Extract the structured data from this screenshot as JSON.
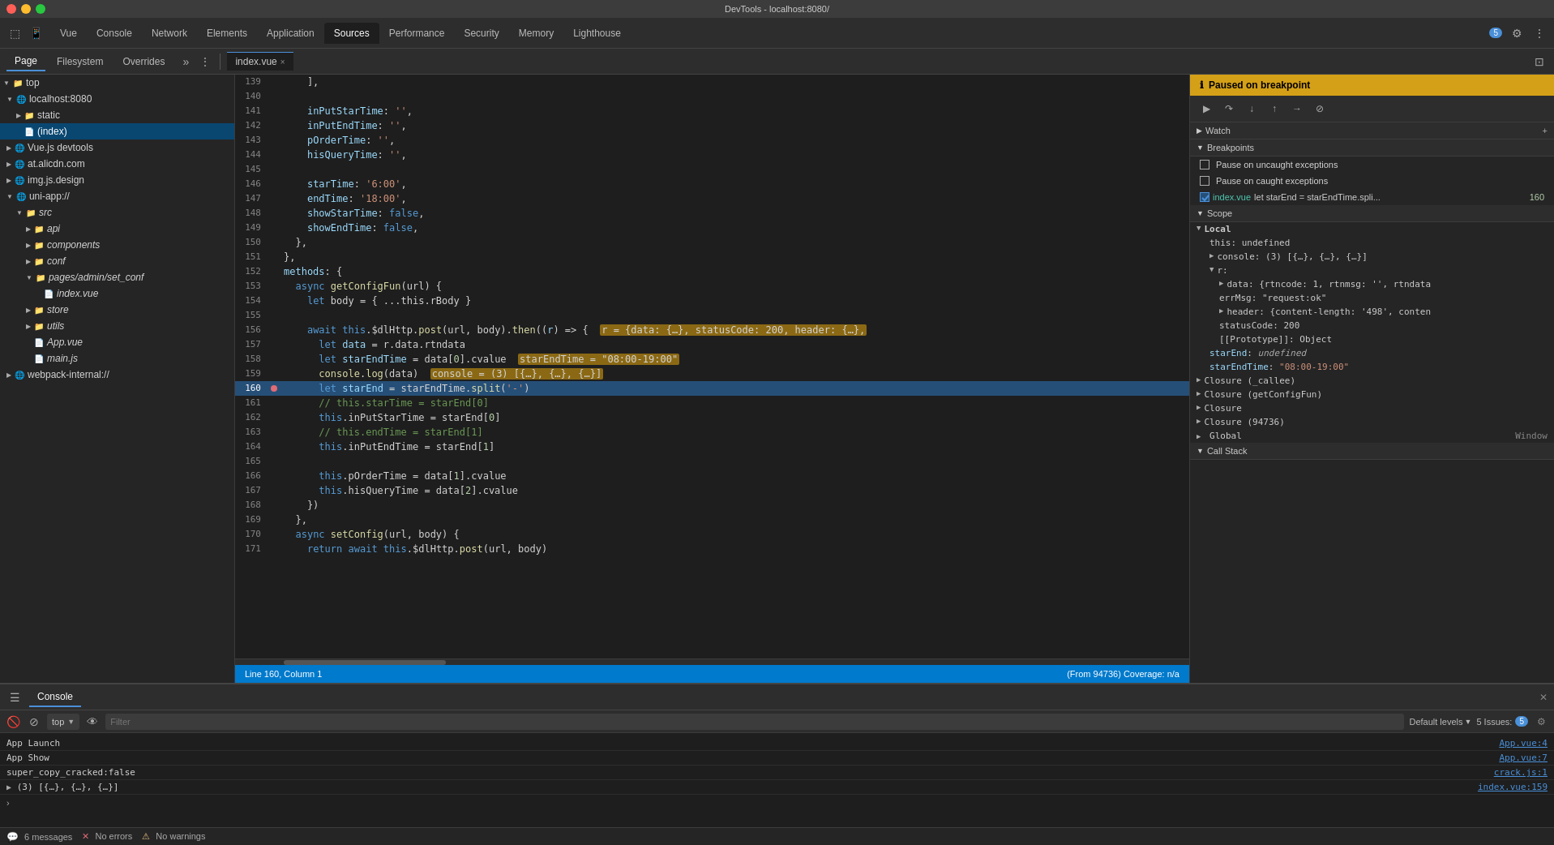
{
  "titlebar": {
    "title": "DevTools - localhost:8080/"
  },
  "nav": {
    "tabs": [
      {
        "label": "Vue",
        "active": false
      },
      {
        "label": "Console",
        "active": false
      },
      {
        "label": "Network",
        "active": false
      },
      {
        "label": "Elements",
        "active": false
      },
      {
        "label": "Application",
        "active": false
      },
      {
        "label": "Sources",
        "active": true
      },
      {
        "label": "Performance",
        "active": false
      },
      {
        "label": "Security",
        "active": false
      },
      {
        "label": "Memory",
        "active": false
      },
      {
        "label": "Lighthouse",
        "active": false
      }
    ],
    "badge": "5",
    "settings_label": "⚙",
    "more_label": "⋮"
  },
  "subtabs": [
    {
      "label": "Page",
      "active": true
    },
    {
      "label": "Filesystem",
      "active": false
    },
    {
      "label": "Overrides",
      "active": false
    }
  ],
  "file_tab": {
    "label": "index.vue",
    "close": "×"
  },
  "sidebar": {
    "items": [
      {
        "label": "top",
        "indent": 0,
        "type": "folder",
        "expanded": true
      },
      {
        "label": "localhost:8080",
        "indent": 1,
        "type": "globe",
        "expanded": true
      },
      {
        "label": "static",
        "indent": 2,
        "type": "folder",
        "expanded": true
      },
      {
        "label": "(index)",
        "indent": 2,
        "type": "file",
        "selected": true
      },
      {
        "label": "Vue.js devtools",
        "indent": 1,
        "type": "globe",
        "expanded": false
      },
      {
        "label": "at.alicdn.com",
        "indent": 1,
        "type": "globe",
        "expanded": false
      },
      {
        "label": "img.js.design",
        "indent": 1,
        "type": "globe",
        "expanded": false
      },
      {
        "label": "uni-app://",
        "indent": 1,
        "type": "globe",
        "expanded": true
      },
      {
        "label": "src",
        "indent": 2,
        "type": "folder",
        "expanded": true
      },
      {
        "label": "api",
        "indent": 3,
        "type": "folder",
        "expanded": false
      },
      {
        "label": "components",
        "indent": 3,
        "type": "folder",
        "expanded": false
      },
      {
        "label": "conf",
        "indent": 3,
        "type": "folder",
        "expanded": false
      },
      {
        "label": "pages/admin/set_conf",
        "indent": 3,
        "type": "folder",
        "expanded": true
      },
      {
        "label": "index.vue",
        "indent": 4,
        "type": "file",
        "selected": false
      },
      {
        "label": "store",
        "indent": 3,
        "type": "folder",
        "expanded": false
      },
      {
        "label": "utils",
        "indent": 3,
        "type": "folder",
        "expanded": false
      },
      {
        "label": "App.vue",
        "indent": 3,
        "type": "file",
        "selected": false
      },
      {
        "label": "main.js",
        "indent": 3,
        "type": "file",
        "selected": false
      },
      {
        "label": "webpack-internal://",
        "indent": 1,
        "type": "globe",
        "expanded": false
      }
    ]
  },
  "code": {
    "lines": [
      {
        "num": 139,
        "content": "    ],",
        "breakpoint": false,
        "highlighted": false
      },
      {
        "num": 140,
        "content": "",
        "breakpoint": false,
        "highlighted": false
      },
      {
        "num": 141,
        "content": "    inPutStarTime: '',",
        "breakpoint": false,
        "highlighted": false
      },
      {
        "num": 142,
        "content": "    inPutEndTime: '',",
        "breakpoint": false,
        "highlighted": false
      },
      {
        "num": 143,
        "content": "    pOrderTime: '',",
        "breakpoint": false,
        "highlighted": false
      },
      {
        "num": 144,
        "content": "    hisQueryTime: '',",
        "breakpoint": false,
        "highlighted": false
      },
      {
        "num": 145,
        "content": "",
        "breakpoint": false,
        "highlighted": false
      },
      {
        "num": 146,
        "content": "    starTime: '6:00',",
        "breakpoint": false,
        "highlighted": false
      },
      {
        "num": 147,
        "content": "    endTime: '18:00',",
        "breakpoint": false,
        "highlighted": false
      },
      {
        "num": 148,
        "content": "    showStarTime: false,",
        "breakpoint": false,
        "highlighted": false
      },
      {
        "num": 149,
        "content": "    showEndTime: false,",
        "breakpoint": false,
        "highlighted": false
      },
      {
        "num": 150,
        "content": "  },",
        "breakpoint": false,
        "highlighted": false
      },
      {
        "num": 151,
        "content": "},",
        "breakpoint": false,
        "highlighted": false
      },
      {
        "num": 152,
        "content": "methods: {",
        "breakpoint": false,
        "highlighted": false
      },
      {
        "num": 153,
        "content": "  async getConfigFun(url) {",
        "breakpoint": false,
        "highlighted": false
      },
      {
        "num": 154,
        "content": "    let body = { ...this.rBody }",
        "breakpoint": false,
        "highlighted": false
      },
      {
        "num": 155,
        "content": "",
        "breakpoint": false,
        "highlighted": false
      },
      {
        "num": 156,
        "content": "    await this.$dlHttp.post(url, body).then((r) => {",
        "breakpoint": false,
        "highlighted": false
      },
      {
        "num": 157,
        "content": "      let data = r.data.rtndata",
        "breakpoint": false,
        "highlighted": false
      },
      {
        "num": 158,
        "content": "      let starEndTime = data[0].cvalue",
        "breakpoint": false,
        "highlighted": false
      },
      {
        "num": 159,
        "content": "      console.log(data)",
        "breakpoint": false,
        "highlighted": false
      },
      {
        "num": 160,
        "content": "      let starEnd = starEndTime.split('-')",
        "breakpoint": true,
        "highlighted": true
      },
      {
        "num": 161,
        "content": "      // this.starTime = starEnd[0]",
        "breakpoint": false,
        "highlighted": false
      },
      {
        "num": 162,
        "content": "      this.inPutStarTime = starEnd[0]",
        "breakpoint": false,
        "highlighted": false
      },
      {
        "num": 163,
        "content": "      // this.endTime = starEnd[1]",
        "breakpoint": false,
        "highlighted": false
      },
      {
        "num": 164,
        "content": "      this.inPutEndTime = starEnd[1]",
        "breakpoint": false,
        "highlighted": false
      },
      {
        "num": 165,
        "content": "",
        "breakpoint": false,
        "highlighted": false
      },
      {
        "num": 166,
        "content": "      this.pOrderTime = data[1].cvalue",
        "breakpoint": false,
        "highlighted": false
      },
      {
        "num": 167,
        "content": "      this.hisQueryTime = data[2].cvalue",
        "breakpoint": false,
        "highlighted": false
      },
      {
        "num": 168,
        "content": "    })",
        "breakpoint": false,
        "highlighted": false
      },
      {
        "num": 169,
        "content": "  },",
        "breakpoint": false,
        "highlighted": false
      },
      {
        "num": 170,
        "content": "  async setConfig(url, body) {",
        "breakpoint": false,
        "highlighted": false
      },
      {
        "num": 171,
        "content": "    return await this.$dlHttp.post(url, body)",
        "breakpoint": false,
        "highlighted": false
      }
    ],
    "status_left": "Line 160, Column 1",
    "status_right": "(From 94736)  Coverage: n/a"
  },
  "debug_panel": {
    "header": "Paused on breakpoint",
    "watch_label": "Watch",
    "breakpoints_label": "Breakpoints",
    "pause_uncaught": "Pause on uncaught exceptions",
    "pause_caught": "Pause on caught exceptions",
    "breakpoint_file": "index.vue",
    "breakpoint_line_label": "let starEnd = starEndTime.spli...",
    "breakpoint_line_num": "160",
    "scope_label": "Scope",
    "local_label": "Local",
    "this_label": "this: undefined",
    "console_label": "console: (3) [{…}, {…}, {…}]",
    "r_label": "r:",
    "data_label": "data: {rtncode: 1, rtnmsg: '', rtndata",
    "errMsg_label": "errMsg: \"request:ok\"",
    "header_label": "header: {content-length: '498', conten",
    "statusCode_label": "statusCode: 200",
    "prototype_label": "[[Prototype]]: Object",
    "starEnd_label": "starEnd: undefined",
    "starEndTime_label": "starEndTime: \"08:00-19:00\"",
    "closure_callee": "Closure (_callee)",
    "closure_getConfig": "Closure (getConfigFun)",
    "closure_plain": "Closure",
    "closure_94736": "Closure (94736)",
    "global_label": "Global",
    "window_label": "Window",
    "call_stack_label": "Call Stack"
  },
  "console": {
    "tab_label": "Console",
    "filter_placeholder": "Filter",
    "default_levels": "Default levels",
    "issues_count": "5 Issues:",
    "issues_badge": "5",
    "messages_count": "6 messages",
    "target_label": "top",
    "messages": [
      {
        "text": "App Launch",
        "source": "App.vue:4"
      },
      {
        "text": "App Show",
        "source": "App.vue:7"
      },
      {
        "text": "super_copy_cracked:false",
        "source": "crack.js:1"
      },
      {
        "text": "▶ (3) [{…}, {…}, {…}]",
        "source": "index.vue:159"
      }
    ],
    "footer_errors": "No errors",
    "footer_warnings": "No warnings"
  },
  "tooltips": {
    "line158": "starEndTime = \"08:00-19:00\"",
    "line156": "r = {data: {…}, statusCode: 200, header: {…},",
    "line159": "console = (3) [{…}, {…}, {…}]"
  }
}
